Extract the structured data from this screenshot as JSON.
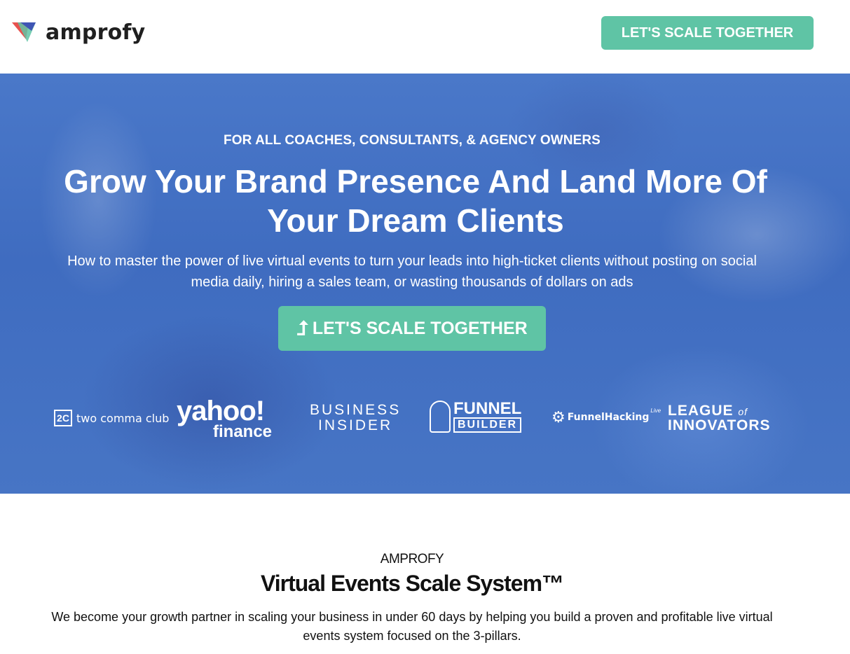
{
  "header": {
    "logo_text": "amprofy",
    "cta_label": "LET'S SCALE TOGETHER"
  },
  "hero": {
    "eyebrow": "FOR ALL COACHES, CONSULTANTS, & AGENCY OWNERS",
    "headline": "Grow Your Brand Presence And Land More Of Your Dream Clients",
    "subhead": "How to master the power of live virtual events to turn your leads into high-ticket clients without posting on social media daily, hiring a sales team, or wasting thousands of dollars on ads",
    "cta_label": "LET'S SCALE TOGETHER",
    "cta_icon": "arrow-up-icon",
    "publications": {
      "two_comma_club": "two comma club",
      "yahoo_top": "yahoo!",
      "yahoo_bottom": "finance",
      "business": "BUSINESS",
      "insider": "INSIDER",
      "funnel": "FUNNEL",
      "builder": "BUILDER",
      "funnel_hacking": "FunnelHacking",
      "funnel_hacking_live": "Live",
      "league": "LEAGUE",
      "of": "of",
      "innovators": "INNOVATORS"
    }
  },
  "section": {
    "brand": "AMPROFY",
    "title": "Virtual Events Scale System™",
    "description": "We become your growth partner in scaling your business in under 60 days by helping you build a proven and profitable live virtual events system focused on the 3-pillars."
  },
  "colors": {
    "accent": "#5fc4a5",
    "hero_overlay": "#4a78c9"
  }
}
